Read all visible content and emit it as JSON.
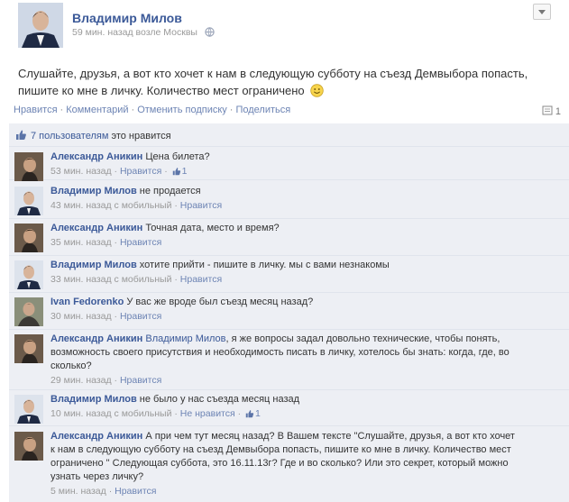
{
  "post": {
    "author": "Владимир Милов",
    "time": "59 мин. назад возле Москвы",
    "text": "Слушайте, друзья, а вот кто хочет к нам в следующую субботу на съезд Демвыбора попасть, пишите ко мне в личку. Количество мест ограничено",
    "actions": [
      "Нравится",
      "Комментарий",
      "Отменить подписку",
      "Поделиться"
    ],
    "comment_count": "1",
    "likes_count": "7 пользователям",
    "likes_suffix": "это нравится"
  },
  "comments": [
    {
      "author": "Александр Аникин",
      "text": "Цена билета?",
      "time": "53 мин. назад",
      "action": "Нравится",
      "likes": "1"
    },
    {
      "author": "Владимир Милов",
      "text": "не продается",
      "time": "43 мин. назад с мобильный",
      "action": "Нравится"
    },
    {
      "author": "Александр Аникин",
      "text": "Точная дата, место и время?",
      "time": "35 мин. назад",
      "action": "Нравится"
    },
    {
      "author": "Владимир Милов",
      "text": "хотите прийти - пишите в личку. мы с вами незнакомы",
      "time": "33 мин. назад с мобильный",
      "action": "Нравится"
    },
    {
      "author": "Ivan Fedorenko",
      "text": "У вас же вроде был съезд месяц назад?",
      "time": "30 мин. назад",
      "action": "Нравится"
    },
    {
      "author": "Александр Аникин",
      "mention": "Владимир Милов",
      "text": ", я же вопросы задал довольно технические, чтобы понять, возможность своего присутствия и необходимость писать в личку, хотелось бы знать: когда, где, во сколько?",
      "time": "29 мин. назад",
      "action": "Нравится"
    },
    {
      "author": "Владимир Милов",
      "text": "не было у нас съезда месяц назад",
      "time": "10 мин. назад с мобильный",
      "action": "Не нравится",
      "likes": "1"
    },
    {
      "author": "Александр Аникин",
      "text": "А при чем тут месяц назад? В Вашем тексте \"Слушайте, друзья, а вот кто хочет к нам в следующую субботу на съезд Демвыбора попасть, пишите ко мне в личку. Количество мест ограничено \" Следующая суббота, это 16.11.13г? Где и во сколько? Или это секрет, который можно узнать через личку?",
      "time": "5 мин. назад",
      "action": "Нравится"
    }
  ]
}
